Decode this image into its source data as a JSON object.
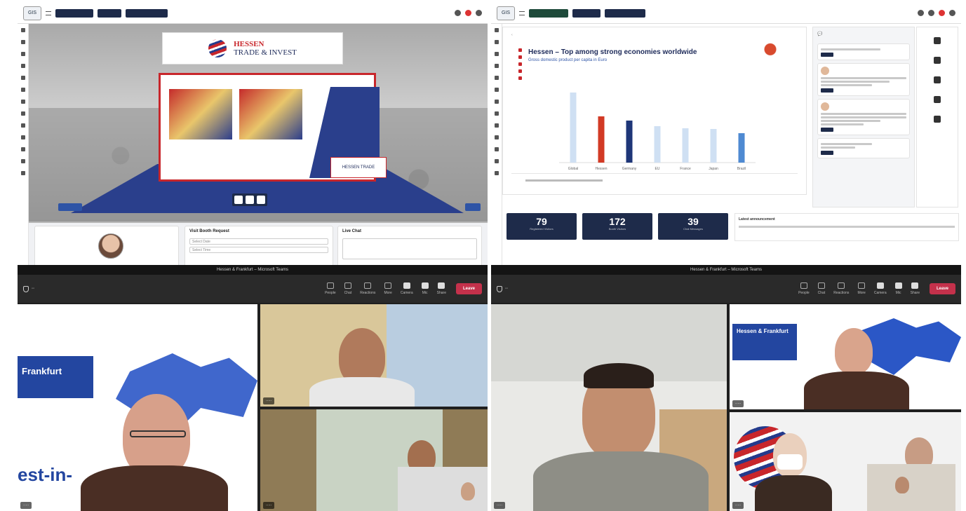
{
  "virtual_fair": {
    "booth_sign_line1": "HESSEN",
    "booth_sign_line2": "TRADE & INVEST",
    "nav": [
      "",
      "",
      ""
    ],
    "scene_buttons": [
      "",
      ""
    ],
    "cards": {
      "visit_booth_request": "Visit Booth Request",
      "live_chat": "Live Chat",
      "field1": "Select Date",
      "field2": "Select Time"
    }
  },
  "dashboard": {
    "title": "Hessen – Top among strong economies worldwide",
    "subtitle": "Gross domestic product per capita in Euro",
    "stats": [
      {
        "value": "79",
        "label": "Registered Visitors"
      },
      {
        "value": "172",
        "label": "Booth Visitors"
      },
      {
        "value": "39",
        "label": "Chat Messages"
      }
    ],
    "info_title": "Latest announcement"
  },
  "chart_data": {
    "type": "bar",
    "categories": [
      "Global",
      "Hessen",
      "Germany",
      "EU",
      "France",
      "Japan",
      "Brazil"
    ],
    "values": [
      100,
      66,
      60,
      52,
      49,
      48,
      42
    ],
    "title": "",
    "xlabel": "",
    "ylabel": "",
    "ylim": [
      0,
      110
    ],
    "colors": [
      "#cfe0f3",
      "#d23a25",
      "#1e3678",
      "#cfe0f3",
      "#cfe0f3",
      "#cfe0f3",
      "#4f8ad2"
    ]
  },
  "meeting_left": {
    "window_title": "Hessen & Frankfurt – Microsoft Teams",
    "slide_heading": "Frankfurt",
    "slide_url_fragment": "est-in-",
    "leave_label": "Leave",
    "toolbar": [
      "People",
      "Chat",
      "Reactions",
      "More",
      "Camera",
      "Mic",
      "Share"
    ]
  },
  "meeting_right": {
    "window_title": "Hessen & Frankfurt – Microsoft Teams",
    "slide_heading": "Hessen & Frankfurt",
    "leave_label": "Leave",
    "toolbar": [
      "People",
      "Chat",
      "Reactions",
      "More",
      "Camera",
      "Mic",
      "Share"
    ]
  }
}
